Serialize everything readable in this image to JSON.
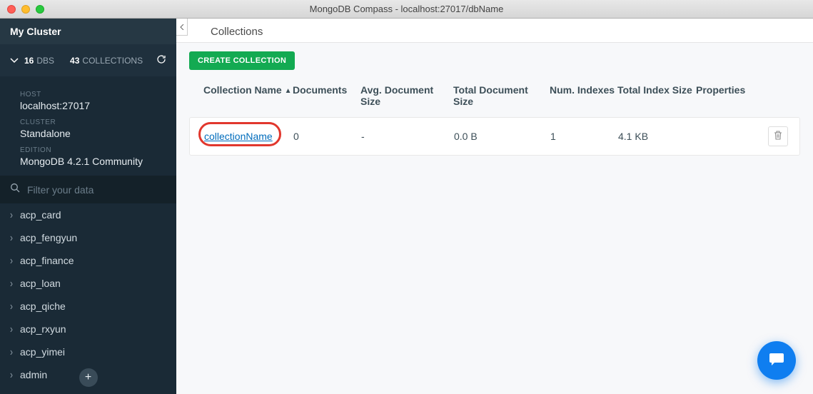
{
  "window": {
    "title": "MongoDB Compass - localhost:27017/dbName"
  },
  "sidebar": {
    "cluster_name": "My Cluster",
    "dbs_count": "16",
    "dbs_label": "DBS",
    "cols_count": "43",
    "cols_label": "COLLECTIONS",
    "host_label": "HOST",
    "host_value": "localhost:27017",
    "cluster_label": "CLUSTER",
    "cluster_value": "Standalone",
    "edition_label": "EDITION",
    "edition_value": "MongoDB 4.2.1 Community",
    "search_placeholder": "Filter your data",
    "dbs": [
      {
        "name": "acp_card"
      },
      {
        "name": "acp_fengyun"
      },
      {
        "name": "acp_finance"
      },
      {
        "name": "acp_loan"
      },
      {
        "name": "acp_qiche"
      },
      {
        "name": "acp_rxyun"
      },
      {
        "name": "acp_yimei"
      },
      {
        "name": "admin"
      }
    ]
  },
  "main": {
    "breadcrumb": "Collections",
    "create_label": "CREATE COLLECTION",
    "headers": {
      "name": "Collection Name",
      "docs": "Documents",
      "avg": "Avg. Document Size",
      "total": "Total Document Size",
      "num_idx": "Num. Indexes",
      "total_idx": "Total Index Size",
      "props": "Properties"
    },
    "rows": [
      {
        "name": "collectionName",
        "docs": "0",
        "avg": "-",
        "total": "0.0 B",
        "num_idx": "1",
        "total_idx": "4.1 KB"
      }
    ]
  }
}
